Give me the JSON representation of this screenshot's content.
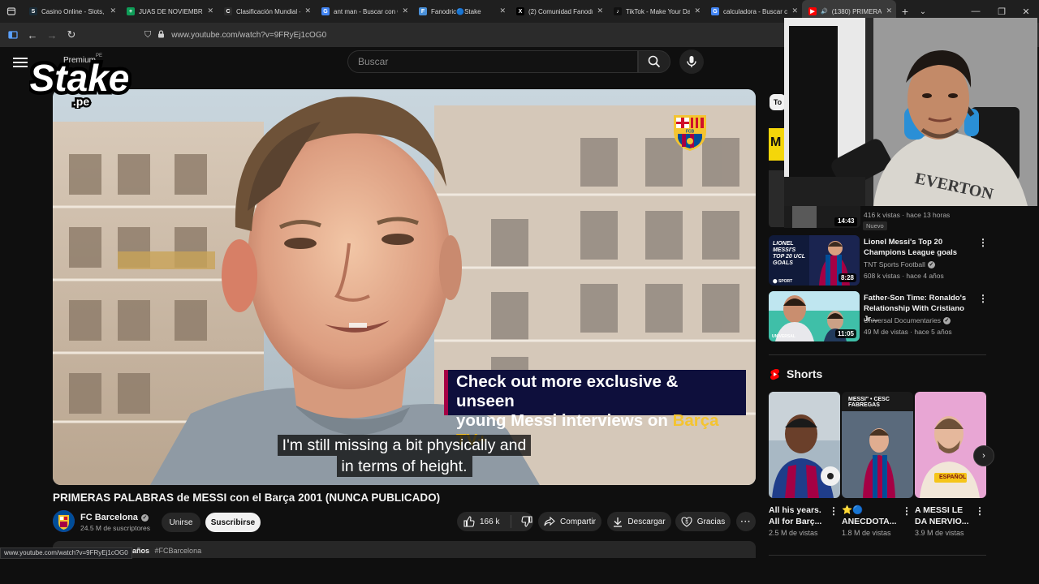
{
  "browser": {
    "tabs": [
      {
        "title": "Casino Online - Slots, J",
        "favicon_color": "#1a2c38",
        "glyph": "S"
      },
      {
        "title": "JUAS DE NOVIEMBRE -",
        "favicon_color": "#0f9d58",
        "glyph": "+"
      },
      {
        "title": "Clasificación Mundial -",
        "favicon_color": "#2c2c2c",
        "glyph": "C"
      },
      {
        "title": "ant man - Buscar con G",
        "favicon_color": "#4285f4",
        "glyph": "G"
      },
      {
        "title": "Fanodric🔵Stake",
        "favicon_color": "#4a90d9",
        "glyph": "F"
      },
      {
        "title": "(2) Comunidad Fanodri",
        "favicon_color": "#000000",
        "glyph": "X"
      },
      {
        "title": "TikTok - Make Your Day",
        "favicon_color": "#111111",
        "glyph": "♪"
      },
      {
        "title": "calculadora - Buscar co",
        "favicon_color": "#4285f4",
        "glyph": "G"
      },
      {
        "title": "(1380) PRIMERAS",
        "favicon_color": "#ff0000",
        "glyph": "▶",
        "active": true
      }
    ],
    "url": "www.youtube.com/watch?v=9FRyEj1cOG0",
    "status_url": "www.youtube.com/watch?v=9FRyEj1cOG0"
  },
  "masthead": {
    "premium_label": "Premium",
    "premium_region": "PE",
    "search_placeholder": "Buscar"
  },
  "overlay": {
    "stake_word": "Stake",
    "stake_tld": ".pe"
  },
  "player": {
    "promo_line1": "Check out more exclusive & unseen",
    "promo_line2_prefix": "young Messi interviews on ",
    "promo_line2_brand": "Barça TV+",
    "subtitle_line1": "I'm still missing a bit physically and",
    "subtitle_line2": "in terms of height.",
    "crest_text": "FCB"
  },
  "video": {
    "title": "PRIMERAS PALABRAS de MESSI con el Barça 2001 (NUNCA PUBLICADO)",
    "channel": "FC Barcelona",
    "subscribers": "24.5 M de suscriptores",
    "join_label": "Unirse",
    "subscribe_label": "Suscribirse",
    "likes": "166 k",
    "share_label": "Compartir",
    "download_label": "Descargar",
    "thanks_label": "Gracias",
    "desc_age": "e 5 años",
    "desc_tag": "#FCBarcelona"
  },
  "sidebar": {
    "chip_label": "To",
    "partial": {
      "meta": "416 k vistas · hace 13 horas",
      "badge": "Nuevo",
      "duration": "14:43"
    },
    "recommendations": [
      {
        "title": "Lionel Messi's Top 20 Champions League goals",
        "channel": "TNT Sports Football",
        "meta": "608 k vistas · hace 4 años",
        "duration": "8:28",
        "thumb_text": "LIONEL MESSI'S TOP 20 UCL GOALS",
        "thumb_brand": "TNT SPORTS"
      },
      {
        "title": "Father-Son Time: Ronaldo's Relationship With Cristiano Jr....",
        "channel": "Universal Documentaries",
        "meta": "49 M de vistas · hace 5 años",
        "duration": "11:05",
        "thumb_brand": "UNIVERSAL"
      }
    ],
    "shorts_heading": "Shorts",
    "shorts": [
      {
        "title": "All his years. All for Barç...",
        "views": "2.5 M de vistas"
      },
      {
        "title": "⭐🔵 ANECDOTA...",
        "views": "1.8 M de vistas",
        "thumb_caption": "MESSI\" • CESC FABREGAS"
      },
      {
        "title": "A MESSI LE DA NERVIO...",
        "views": "3.9 M de vistas",
        "thumb_caption": "ESPAÑOL"
      }
    ]
  },
  "webcam": {
    "shirt_text": "EVERTON"
  },
  "colors": {
    "bg": "#0f0f0f",
    "barca_red": "#a50044",
    "barca_blue": "#004d98",
    "barca_gold": "#f4c430",
    "youtube_red": "#ff0000"
  }
}
